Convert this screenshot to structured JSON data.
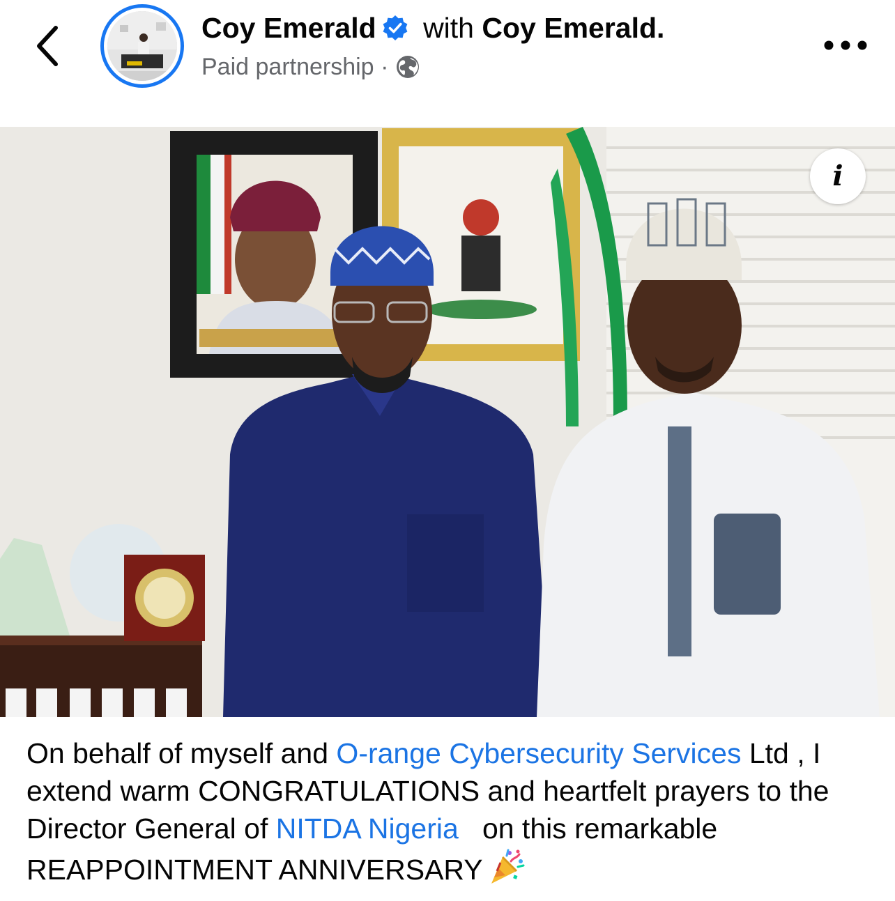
{
  "header": {
    "author_name": "Coy Emerald",
    "with_text": "with",
    "tagged_name": "Coy Emerald.",
    "subtitle": "Paid partnership",
    "separator": "·",
    "privacy_icon": "globe-icon",
    "back_icon": "chevron-left-icon",
    "more_icon": "more-horizontal-icon",
    "verified_icon": "verified-badge-icon"
  },
  "photo": {
    "info_label": "i",
    "info_icon": "info-icon"
  },
  "caption": {
    "part1": "On behalf of myself and ",
    "link1": "O-range Cybersecurity Services",
    "part2": " Ltd , I extend warm CONGRATULATIONS and heartfelt prayers to the Director General of ",
    "link2": "NITDA Nigeria",
    "part3": "   on this remarkable REAPPOINTMENT ANNIVERSARY",
    "emoji_icon": "party-popper-icon"
  },
  "colors": {
    "accent": "#1877f2",
    "link": "#1b74e4",
    "secondary_text": "#65676b",
    "text": "#050505"
  }
}
